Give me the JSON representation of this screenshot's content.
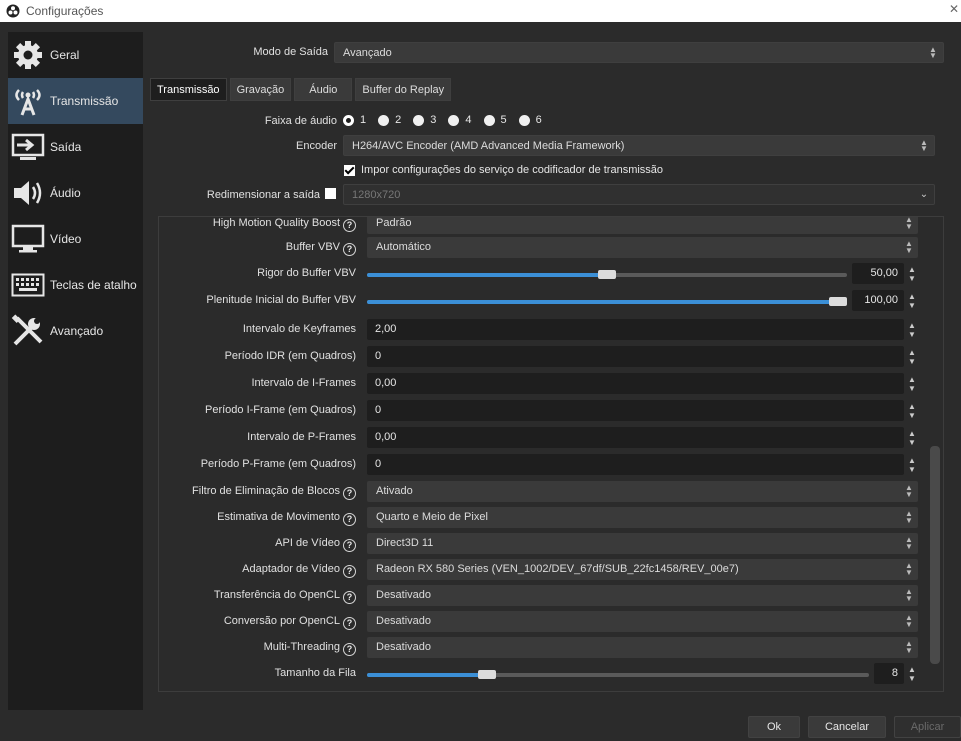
{
  "window": {
    "title": "Configurações"
  },
  "sidebar": {
    "items": [
      {
        "label": "Geral",
        "icon": "gear-icon"
      },
      {
        "label": "Transmissão",
        "icon": "antenna-icon"
      },
      {
        "label": "Saída",
        "icon": "output-icon"
      },
      {
        "label": "Áudio",
        "icon": "speaker-icon"
      },
      {
        "label": "Vídeo",
        "icon": "monitor-icon"
      },
      {
        "label": "Teclas de atalho",
        "icon": "keyboard-icon"
      },
      {
        "label": "Avançado",
        "icon": "tools-icon"
      }
    ],
    "active": "Transmissão"
  },
  "output": {
    "mode_label": "Modo de Saída",
    "mode_value": "Avançado"
  },
  "tabs": [
    "Transmissão",
    "Gravação",
    "Áudio",
    "Buffer do Replay"
  ],
  "stream": {
    "audio_track_label": "Faixa de áudio",
    "audio_tracks": [
      "1",
      "2",
      "3",
      "4",
      "5",
      "6"
    ],
    "audio_track_selected": "1",
    "encoder_label": "Encoder",
    "encoder_value": "H264/AVC Encoder (AMD Advanced Media Framework)",
    "enforce_label": "Impor configurações do serviço de codificador de transmissão",
    "enforce_checked": true,
    "rescale_label": "Redimensionar a saída",
    "rescale_checked": false,
    "rescale_value": "1280x720"
  },
  "encoder_settings": {
    "high_motion_label": "High Motion Quality Boost",
    "high_motion_value": "Padrão",
    "vbv_label": "Buffer VBV",
    "vbv_value": "Automático",
    "vbv_strict_label": "Rigor do Buffer VBV",
    "vbv_strict_value": "50,00",
    "vbv_strict_fraction": 0.5,
    "vbv_fill_label": "Plenitude Inicial do Buffer VBV",
    "vbv_fill_value": "100,00",
    "vbv_fill_fraction": 1.0,
    "keyframe_label": "Intervalo de Keyframes",
    "keyframe_value": "2,00",
    "idr_label": "Período IDR (em Quadros)",
    "idr_value": "0",
    "iframe_interval_label": "Intervalo de I-Frames",
    "iframe_interval_value": "0,00",
    "iframe_period_label": "Período I-Frame (em Quadros)",
    "iframe_period_value": "0",
    "pframe_interval_label": "Intervalo de P-Frames",
    "pframe_interval_value": "0,00",
    "pframe_period_label": "Período P-Frame (em Quadros)",
    "pframe_period_value": "0",
    "deblock_label": "Filtro de Eliminação de Blocos",
    "deblock_value": "Ativado",
    "motion_label": "Estimativa de Movimento",
    "motion_value": "Quarto e Meio de Pixel",
    "api_label": "API de Vídeo",
    "api_value": "Direct3D 11",
    "adapter_label": "Adaptador de Vídeo",
    "adapter_value": "Radeon RX 580 Series (VEN_1002/DEV_67df/SUB_22fc1458/REV_00e7)",
    "opencl_transfer_label": "Transferência do OpenCL",
    "opencl_transfer_value": "Desativado",
    "opencl_convert_label": "Conversão por OpenCL",
    "opencl_convert_value": "Desativado",
    "multithread_label": "Multi-Threading",
    "multithread_value": "Desativado",
    "queue_label": "Tamanho da Fila",
    "queue_value": "8",
    "queue_fraction": 0.24
  },
  "buttons": {
    "ok": "Ok",
    "cancel": "Cancelar",
    "apply": "Aplicar"
  }
}
